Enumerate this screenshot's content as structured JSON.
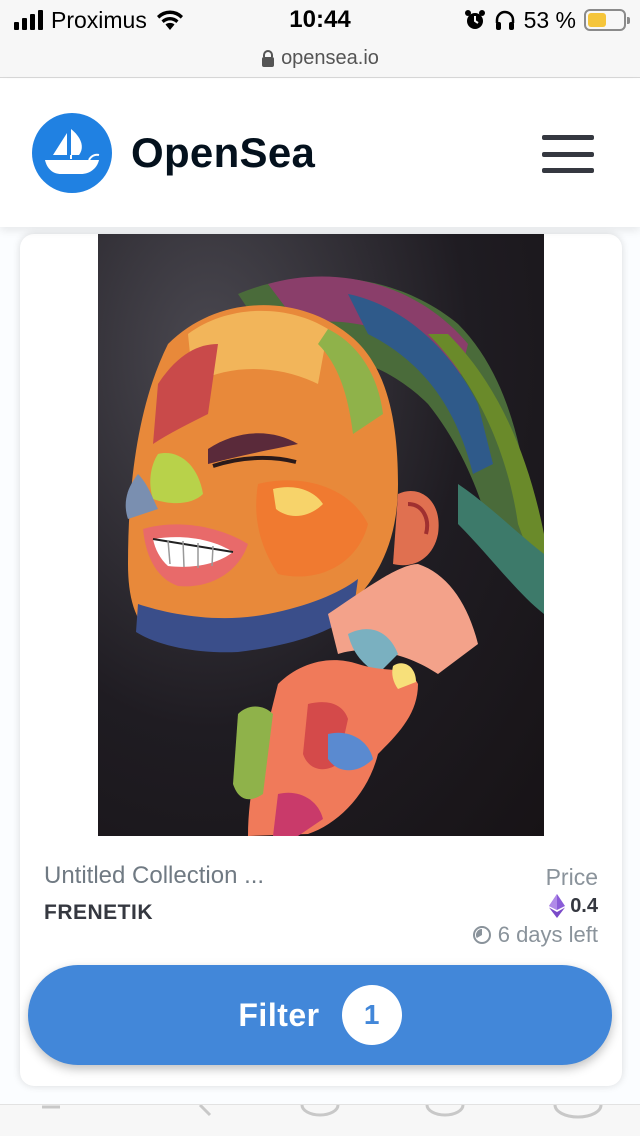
{
  "status_bar": {
    "carrier": "Proximus",
    "time": "10:44",
    "battery_percent": "53 %",
    "battery_level": 0.53,
    "icons": [
      "signal-icon",
      "wifi-icon",
      "alarm-icon",
      "headphones-icon",
      "battery-icon"
    ]
  },
  "browser": {
    "url": "opensea.io",
    "url_icon": "lock-icon"
  },
  "header": {
    "brand": "OpenSea",
    "logo_icon": "sailboat-icon",
    "menu_icon": "hamburger-menu-icon",
    "brand_color": "#2081e2"
  },
  "asset": {
    "collection": "Untitled Collection ...",
    "name": "FRENETIK",
    "price_label": "Price",
    "price": "0.4",
    "currency_icon": "ethereum-icon",
    "time_left": "6 days left",
    "time_icon": "clock-icon"
  },
  "filter": {
    "label": "Filter",
    "count": "1",
    "color": "#4287d9"
  }
}
